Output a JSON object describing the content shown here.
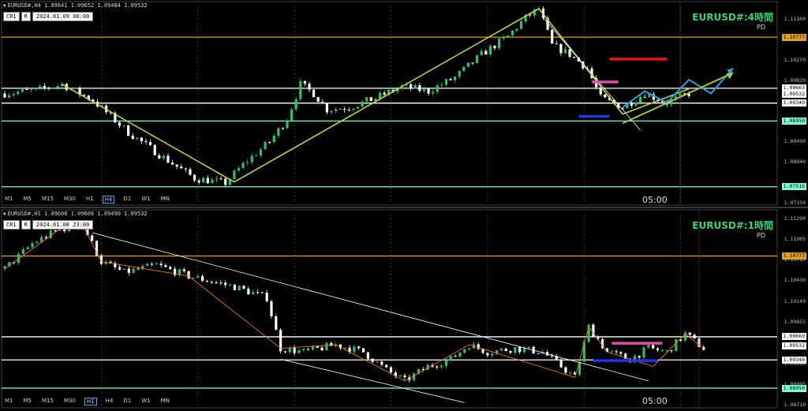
{
  "panels": [
    {
      "id": "h4",
      "header": "EURUSD#,H4  1.09641 1.09652 1.09484 1.09532",
      "btn_a": "CR1",
      "btn_b": "R",
      "date_label": "2024.01.09 00:00",
      "title": "EURUSD#:4時間",
      "sub": "PD",
      "time_label": "05:00",
      "timeframes": [
        "M1",
        "M5",
        "M15",
        "M30",
        "H1",
        "H4",
        "D1",
        "W1",
        "MN"
      ],
      "active_tf": "H4",
      "price_range": [
        1.0715,
        1.1145
      ],
      "ticks": [
        "1.11160",
        "1.10770",
        "1.10270",
        "1.09820",
        "1.09340",
        "1.08950",
        "1.08490",
        "1.08040",
        "1.07516",
        "1.07150"
      ],
      "badges": [
        {
          "label": "1.10777",
          "value": 1.10777,
          "color": "#e0a020"
        },
        {
          "label": "1.09663",
          "value": 1.09663,
          "color": "#ffffff"
        },
        {
          "label": "1.09532",
          "value": 1.09532,
          "color": "#ffffff"
        },
        {
          "label": "1.09340",
          "value": 1.0934,
          "color": "#ffffff"
        },
        {
          "label": "1.08950",
          "value": 1.0895,
          "color": "#7fffd4"
        },
        {
          "label": "1.07516",
          "value": 1.07516,
          "color": "#7fffd4"
        }
      ]
    },
    {
      "id": "h1",
      "header": "EURUSD#,H1  1.09606 1.09606 1.09490 1.09532",
      "btn_a": "CR1",
      "btn_b": "R",
      "date_label": "2024.01.08 23:00",
      "title": "EURUSD#:1時間",
      "sub": "PD",
      "time_label": "05:00",
      "timeframes": [
        "M1",
        "M5",
        "M15",
        "M30",
        "H1",
        "H4",
        "D1",
        "W1",
        "MN"
      ],
      "active_tf": "H1",
      "price_range": [
        1.0871,
        1.1135
      ],
      "ticks": [
        "1.11290",
        "1.11005",
        "1.10715",
        "1.10430",
        "1.10140",
        "1.09855",
        "1.09550",
        "1.09280",
        "1.08995",
        "1.08710"
      ],
      "badges": [
        {
          "label": "1.10777",
          "value": 1.10777,
          "color": "#e0a020"
        },
        {
          "label": "1.09660",
          "value": 1.0966,
          "color": "#ffffff"
        },
        {
          "label": "1.09532",
          "value": 1.09532,
          "color": "#ffffff"
        },
        {
          "label": "1.09340",
          "value": 1.0934,
          "color": "#ffffff"
        },
        {
          "label": "1.08950",
          "value": 1.0895,
          "color": "#7fffd4"
        }
      ]
    }
  ],
  "chart_data": [
    {
      "type": "candlestick",
      "title": "EURUSD#:4時間",
      "ylim": [
        1.0715,
        1.1145
      ],
      "levels": [
        {
          "price": 1.10777,
          "color": "#e0a020"
        },
        {
          "price": 1.09663,
          "color": "#ffffff"
        },
        {
          "price": 1.0934,
          "color": "#ffffff"
        },
        {
          "price": 1.0895,
          "color": "#7fffd4"
        },
        {
          "price": 1.07516,
          "color": "#7fffd4"
        }
      ],
      "path": [
        [
          0,
          1.0955
        ],
        [
          7,
          1.0962
        ],
        [
          13,
          1.0975
        ],
        [
          20,
          1.094
        ],
        [
          28,
          1.087
        ],
        [
          36,
          1.0815
        ],
        [
          43,
          1.077
        ],
        [
          50,
          1.076
        ],
        [
          54,
          1.08
        ],
        [
          60,
          1.085
        ],
        [
          64,
          1.09
        ],
        [
          67,
          1.0975
        ],
        [
          70,
          1.0955
        ],
        [
          73,
          1.092
        ],
        [
          78,
          1.0925
        ],
        [
          84,
          1.0945
        ],
        [
          90,
          1.097
        ],
        [
          96,
          1.096
        ],
        [
          102,
          1.099
        ],
        [
          108,
          1.104
        ],
        [
          114,
          1.108
        ],
        [
          118,
          1.112
        ],
        [
          121,
          1.114
        ],
        [
          124,
          1.106
        ],
        [
          128,
          1.104
        ],
        [
          132,
          1.101
        ],
        [
          135,
          1.0945
        ],
        [
          140,
          1.0925
        ],
        [
          145,
          1.0955
        ],
        [
          150,
          1.0935
        ],
        [
          155,
          1.0955
        ]
      ],
      "zigzag": [
        [
          13,
          1.0975
        ],
        [
          52,
          1.0762
        ],
        [
          121,
          1.114
        ],
        [
          140,
          1.091
        ],
        [
          155,
          1.0965
        ]
      ],
      "scenario_blue": [
        [
          140,
          1.0925
        ],
        [
          145,
          1.096
        ],
        [
          150,
          1.0935
        ],
        [
          155,
          1.0985
        ],
        [
          160,
          1.0955
        ],
        [
          165,
          1.101
        ]
      ],
      "scenario_green": [
        [
          140,
          1.089
        ],
        [
          165,
          1.1
        ]
      ],
      "trend_white": [
        [
          122,
          1.112
        ],
        [
          144,
          1.0875
        ]
      ],
      "marks": [
        {
          "x0": 133,
          "x1": 139,
          "price": 1.098,
          "color": "#e04ca8"
        },
        {
          "x0": 137,
          "x1": 150,
          "price": 1.103,
          "color": "#e01818"
        },
        {
          "x0": 130,
          "x1": 137,
          "price": 1.0905,
          "color": "#2034e8"
        }
      ],
      "vline_x": 153
    },
    {
      "type": "candlestick",
      "title": "EURUSD#:1時間",
      "ylim": [
        1.0871,
        1.1135
      ],
      "levels": [
        {
          "price": 1.10777,
          "color": "#e0a020"
        },
        {
          "price": 1.0966,
          "color": "#ffffff"
        },
        {
          "price": 1.0934,
          "color": "#ffffff"
        },
        {
          "price": 1.0895,
          "color": "#7fffd4"
        }
      ],
      "path": [
        [
          0,
          1.106
        ],
        [
          6,
          1.1095
        ],
        [
          12,
          1.1115
        ],
        [
          17,
          1.112
        ],
        [
          21,
          1.107
        ],
        [
          26,
          1.1055
        ],
        [
          33,
          1.1065
        ],
        [
          40,
          1.105
        ],
        [
          50,
          1.1035
        ],
        [
          57,
          1.102
        ],
        [
          60,
          1.095
        ],
        [
          65,
          1.0945
        ],
        [
          72,
          1.0955
        ],
        [
          78,
          1.0945
        ],
        [
          83,
          1.092
        ],
        [
          87,
          1.0905
        ],
        [
          92,
          1.0925
        ],
        [
          97,
          1.0935
        ],
        [
          101,
          1.0955
        ],
        [
          105,
          1.0945
        ],
        [
          111,
          1.095
        ],
        [
          117,
          1.0945
        ],
        [
          121,
          1.0925
        ],
        [
          124,
          1.091
        ],
        [
          127,
          1.098
        ],
        [
          131,
          1.0945
        ],
        [
          136,
          1.0935
        ],
        [
          140,
          1.095
        ],
        [
          144,
          1.0945
        ],
        [
          148,
          1.097
        ],
        [
          152,
          1.095
        ]
      ],
      "zigzag": [
        [
          0,
          1.106
        ],
        [
          12,
          1.1115
        ],
        [
          17,
          1.112
        ],
        [
          21,
          1.107
        ],
        [
          40,
          1.105
        ],
        [
          60,
          1.095
        ],
        [
          72,
          1.0955
        ],
        [
          87,
          1.0905
        ],
        [
          101,
          1.0955
        ],
        [
          124,
          1.091
        ],
        [
          127,
          1.098
        ],
        [
          131,
          1.0945
        ],
        [
          141,
          1.0925
        ],
        [
          148,
          1.097
        ],
        [
          152,
          1.095
        ]
      ],
      "trend_white": [
        [
          19,
          1.111
        ],
        [
          140,
          1.0905
        ]
      ],
      "trend_white_2": [
        [
          60,
          1.0935
        ],
        [
          100,
          1.0875
        ]
      ],
      "marks": [
        {
          "x0": 132,
          "x1": 143,
          "price": 1.0957,
          "color": "#e04ca8"
        },
        {
          "x0": 128,
          "x1": 142,
          "price": 1.0933,
          "color": "#2034e8"
        }
      ],
      "vline_x": 151
    }
  ]
}
